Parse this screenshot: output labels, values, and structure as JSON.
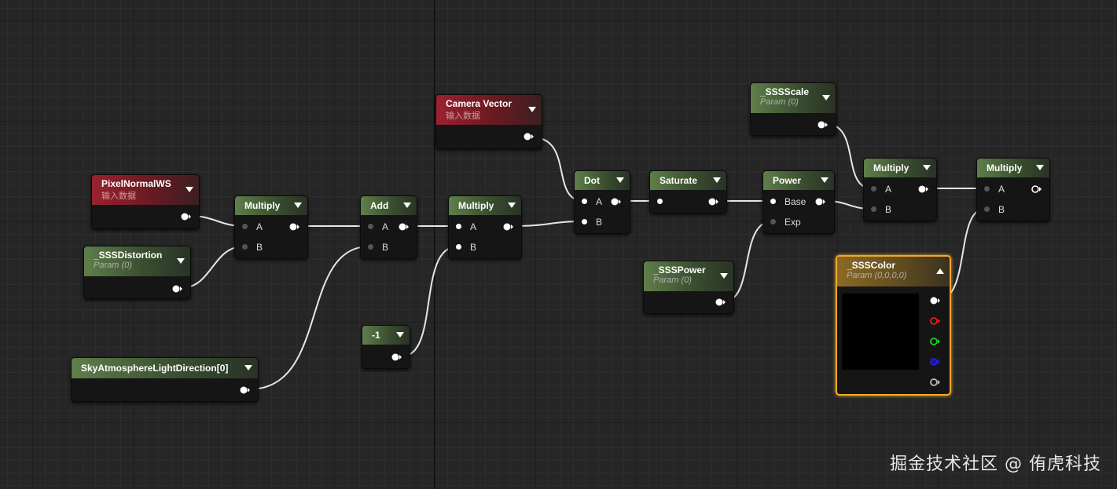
{
  "nodes": {
    "pixel_normal": {
      "title": "PixelNormalWS",
      "subtitle": "输入数据"
    },
    "sss_distortion": {
      "title": "_SSSDistortion",
      "subtitle": "Param (0)"
    },
    "sky_light": {
      "title": "SkyAtmosphereLightDirection[0]"
    },
    "multiply1": {
      "title": "Multiply",
      "pin_a": "A",
      "pin_b": "B"
    },
    "add": {
      "title": "Add",
      "pin_a": "A",
      "pin_b": "B"
    },
    "const_neg1": {
      "title": "-1"
    },
    "multiply2": {
      "title": "Multiply",
      "pin_a": "A",
      "pin_b": "B"
    },
    "camera_vector": {
      "title": "Camera Vector",
      "subtitle": "输入数据"
    },
    "dot": {
      "title": "Dot",
      "pin_a": "A",
      "pin_b": "B"
    },
    "saturate": {
      "title": "Saturate"
    },
    "power": {
      "title": "Power",
      "pin_a": "Base",
      "pin_b": "Exp"
    },
    "sss_power": {
      "title": "_SSSPower",
      "subtitle": "Param (0)"
    },
    "sss_scale": {
      "title": "_SSSScale",
      "subtitle": "Param (0)"
    },
    "multiply3": {
      "title": "Multiply",
      "pin_a": "A",
      "pin_b": "B"
    },
    "multiply4": {
      "title": "Multiply",
      "pin_a": "A",
      "pin_b": "B"
    },
    "sss_color": {
      "title": "_SSSColor",
      "subtitle": "Param (0,0,0,0)"
    }
  },
  "watermark": "掘金技术社区 @ 侑虎科技",
  "colors": {
    "background": "#262626",
    "node_body": "#151515",
    "param_header": "#5f7f4a",
    "input_header": "#9a2230",
    "selection": "#f0a830",
    "wire": "#e6e6e6"
  }
}
